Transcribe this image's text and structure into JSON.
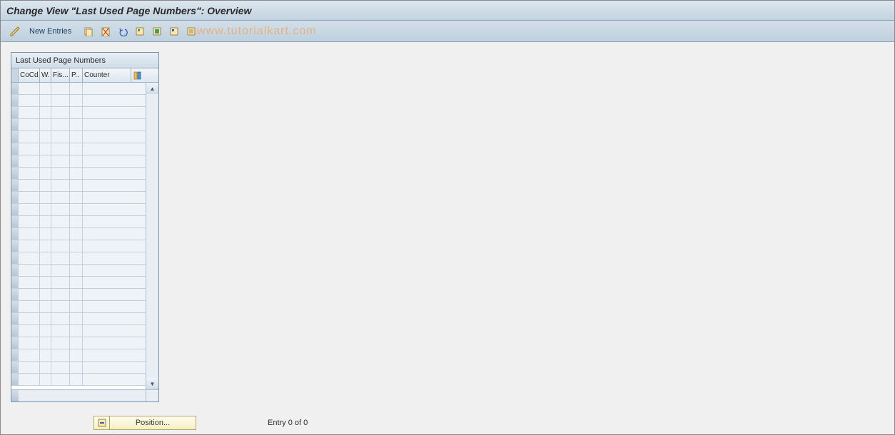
{
  "title": "Change View \"Last Used Page Numbers\": Overview",
  "toolbar": {
    "new_entries_label": "New Entries"
  },
  "watermark": "www.tutorialkart.com",
  "panel": {
    "header": "Last Used Page Numbers",
    "columns": {
      "cocd": "CoCd",
      "w": "W.",
      "fis": "Fis...",
      "p": "P..",
      "counter": "Counter"
    }
  },
  "bottom": {
    "position_label": "Position...",
    "entry_status": "Entry 0 of 0"
  }
}
